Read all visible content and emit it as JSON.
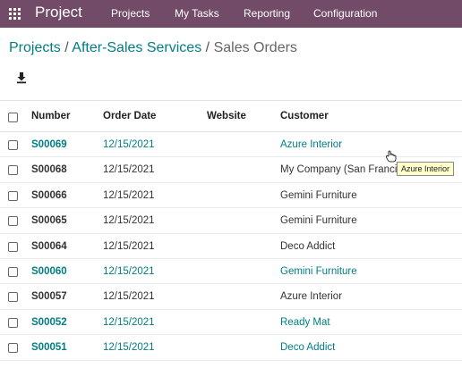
{
  "navbar": {
    "app_icon": "apps-grid-icon",
    "brand": "Project",
    "items": [
      "Projects",
      "My Tasks",
      "Reporting",
      "Configuration"
    ]
  },
  "breadcrumb": {
    "items": [
      "Projects",
      "After-Sales Services"
    ],
    "separator": "/",
    "current": "Sales Orders"
  },
  "toolbar": {
    "download_icon": "download-icon"
  },
  "table": {
    "columns": [
      "Number",
      "Order Date",
      "Website",
      "Customer"
    ],
    "rows": [
      {
        "number": "S00069",
        "date": "12/15/2021",
        "website": "",
        "customer": "Azure Interior",
        "linked": true
      },
      {
        "number": "S00068",
        "date": "12/15/2021",
        "website": "",
        "customer": "My Company (San Franci",
        "linked": false
      },
      {
        "number": "S00066",
        "date": "12/15/2021",
        "website": "",
        "customer": "Gemini Furniture",
        "linked": false
      },
      {
        "number": "S00065",
        "date": "12/15/2021",
        "website": "",
        "customer": "Gemini Furniture",
        "linked": false
      },
      {
        "number": "S00064",
        "date": "12/15/2021",
        "website": "",
        "customer": "Deco Addict",
        "linked": false
      },
      {
        "number": "S00060",
        "date": "12/15/2021",
        "website": "",
        "customer": "Gemini Furniture",
        "linked": true
      },
      {
        "number": "S00057",
        "date": "12/15/2021",
        "website": "",
        "customer": "Azure Interior",
        "linked": false
      },
      {
        "number": "S00052",
        "date": "12/15/2021",
        "website": "",
        "customer": "Ready Mat",
        "linked": true
      },
      {
        "number": "S00051",
        "date": "12/15/2021",
        "website": "",
        "customer": "Deco Addict",
        "linked": true
      }
    ]
  },
  "tooltip": {
    "text": "Azure Interior"
  },
  "colors": {
    "navbar_bg": "#714b67",
    "link": "#017e84"
  }
}
